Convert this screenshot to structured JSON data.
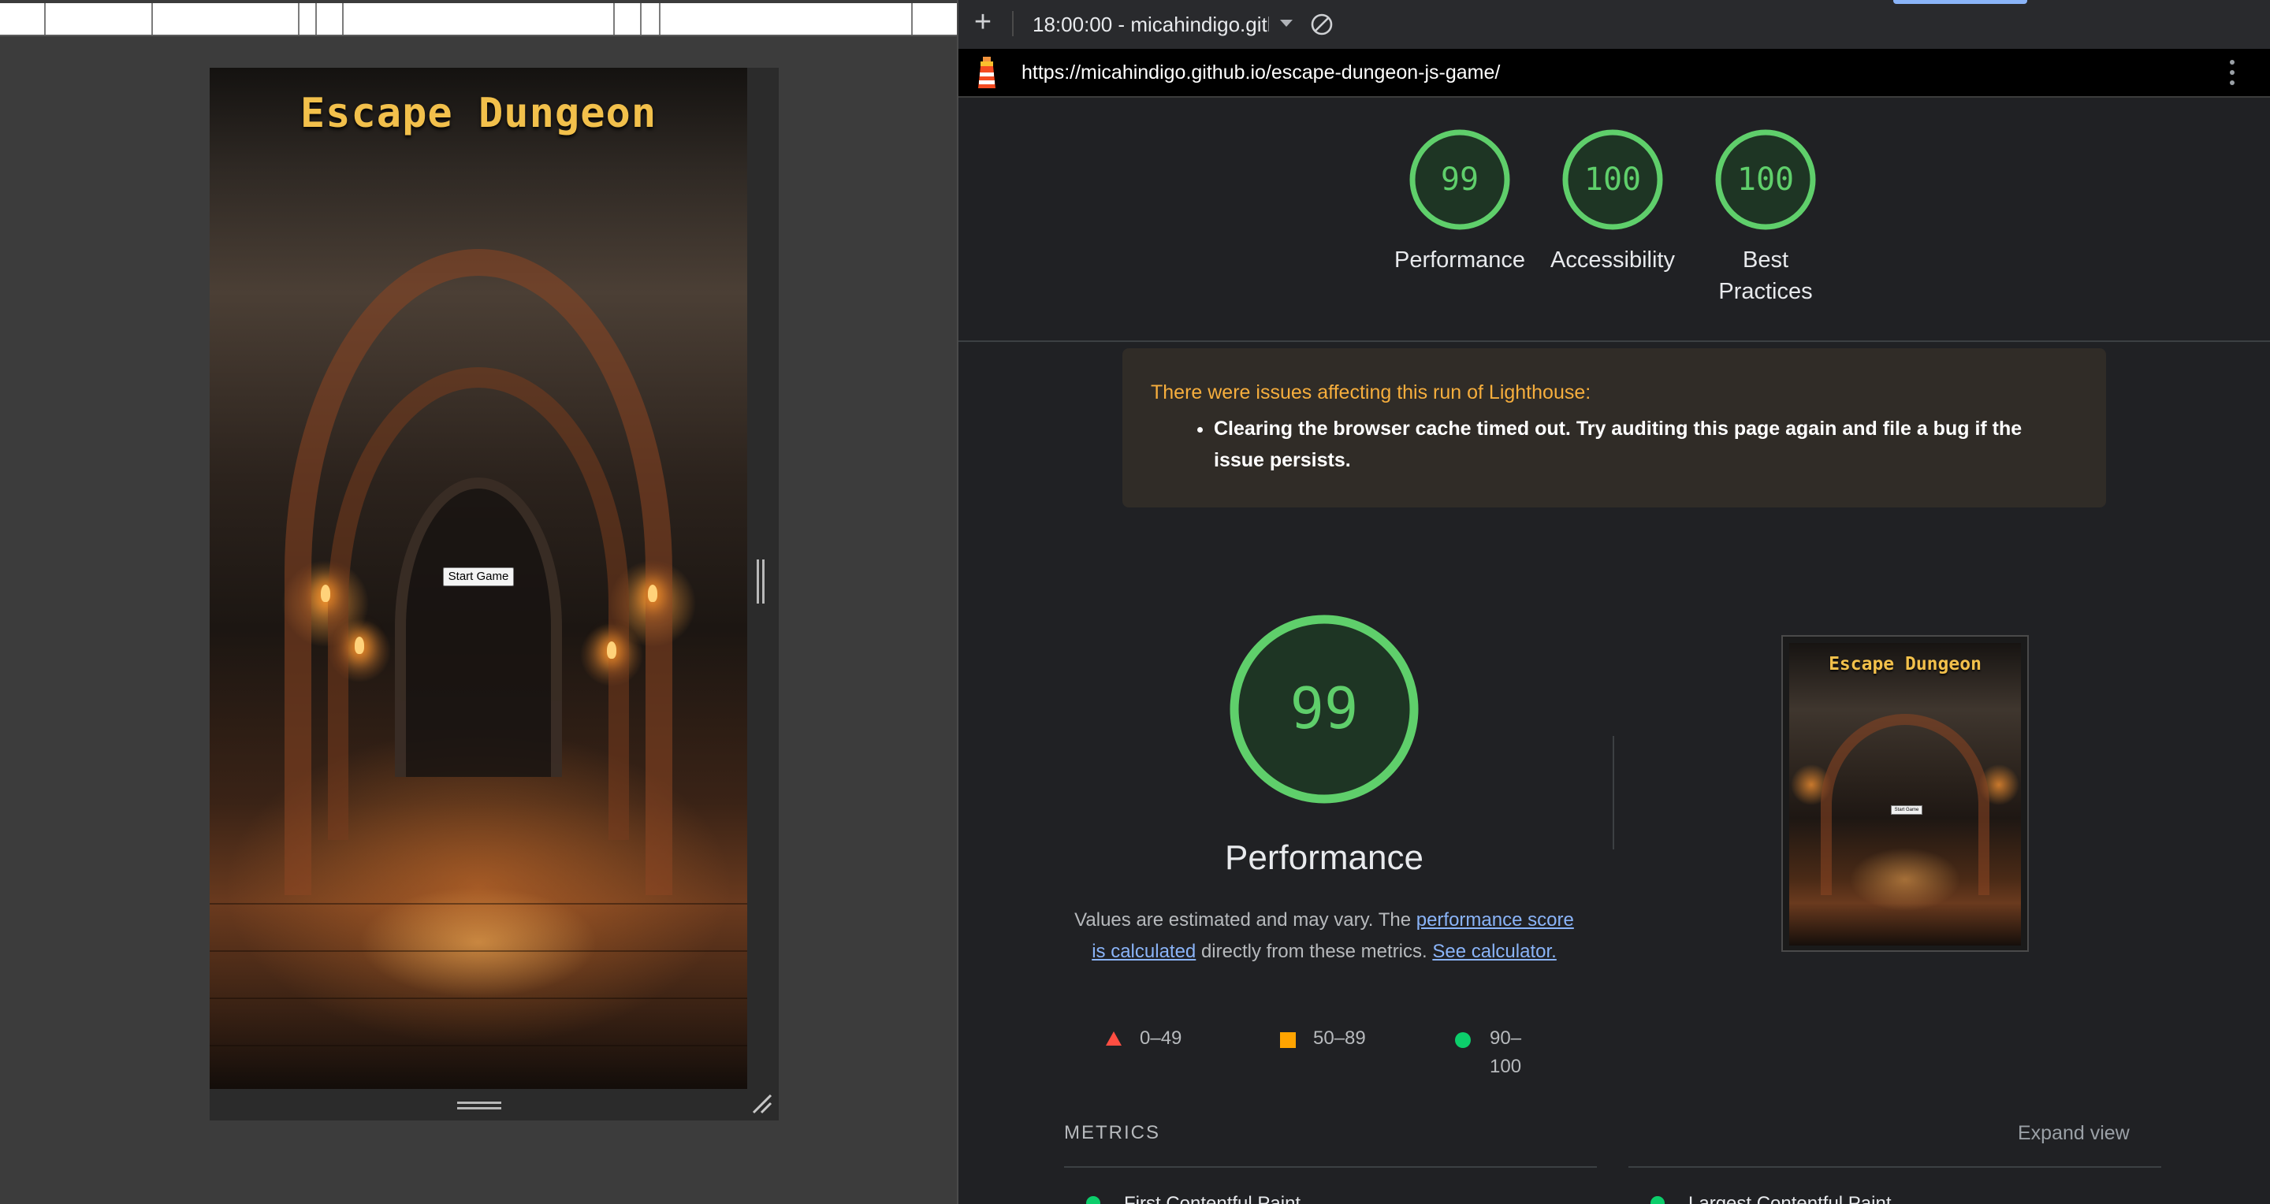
{
  "preview": {
    "game_title": "Escape Dungeon",
    "start_button": "Start Game"
  },
  "devtools": {
    "toolbar": {
      "new_report_icon": "plus-icon",
      "report_selector": "18:00:00 - micahindigo.gitl",
      "clear_icon": "block-icon"
    },
    "url": "https://micahindigo.github.io/escape-dungeon-js-game/",
    "score_gauges": [
      {
        "score": "99",
        "label": "Performance"
      },
      {
        "score": "100",
        "label": "Accessibility"
      },
      {
        "score": "100",
        "label": "Best Practices"
      }
    ],
    "warning": {
      "title": "There were issues affecting this run of Lighthouse:",
      "items": [
        "Clearing the browser cache timed out. Try auditing this page again and file a bug if the issue persists."
      ]
    },
    "performance": {
      "score": "99",
      "title": "Performance",
      "desc_prefix": "Values are estimated and may vary. The ",
      "desc_link1": "performance score is calculated",
      "desc_middle": " directly from these metrics. ",
      "desc_link2": "See calculator."
    },
    "legend": [
      {
        "range": "0–49",
        "color": "#ff4e42",
        "shape": "triangle"
      },
      {
        "range": "50–89",
        "color": "#ffa400",
        "shape": "square"
      },
      {
        "range": "90–100",
        "color": "#0cce6b",
        "shape": "circle"
      }
    ],
    "thumbnail": {
      "title": "Escape Dungeon",
      "button": "Start Game"
    },
    "metrics": {
      "heading": "METRICS",
      "expand_label": "Expand view",
      "items": [
        "First Contentful Paint",
        "Largest Contentful Paint"
      ]
    },
    "colors": {
      "pass_green": "#0cce6b",
      "gauge_ring": "#5fcf6b",
      "link_blue": "#8ab4f8",
      "warning_orange": "#f6ae3d",
      "game_title_gold": "#f2c04b"
    }
  }
}
